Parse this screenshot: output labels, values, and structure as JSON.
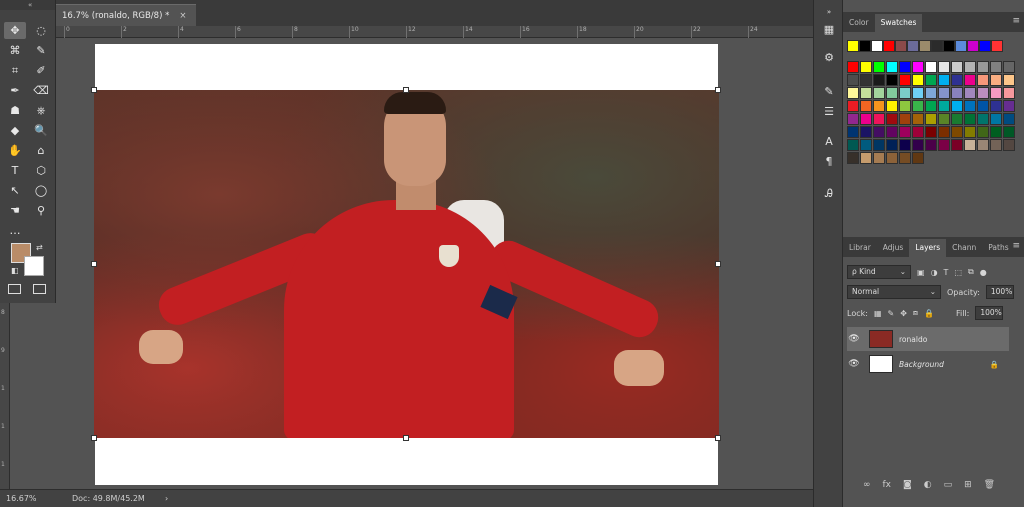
{
  "document": {
    "tab_title": "16.7% (ronaldo, RGB/8) *",
    "tab_close": "×"
  },
  "rulers": {
    "top_labels": [
      "0",
      "2",
      "4",
      "6",
      "8",
      "10",
      "12",
      "14",
      "16",
      "18",
      "20",
      "22",
      "24"
    ],
    "left_labels": [
      "8",
      "9",
      "1",
      "1",
      "1"
    ]
  },
  "toolbar": {
    "collapse": "«",
    "tools": [
      "✥",
      "◌",
      "⌘",
      "✎",
      "⌗",
      "✐",
      "✒",
      "⌫",
      "☗",
      "⎈",
      "◆",
      "🔍",
      "✋",
      "⌂",
      "T",
      "⬡",
      "↖",
      "◯",
      "☚",
      "⚲",
      "…"
    ]
  },
  "status": {
    "zoom": "16.67%",
    "doc_size": "Doc: 49.8M/45.2M",
    "arrow": "›"
  },
  "panels": {
    "color_tabs": [
      "Color",
      "Swatches"
    ],
    "layers_tabs": [
      "Librar",
      "Adjus",
      "Layers",
      "Chann",
      "Paths"
    ],
    "kind_label": "ρ Kind",
    "blend_mode": "Normal",
    "opacity_label": "Opacity:",
    "opacity_value": "100%",
    "lock_label": "Lock:",
    "fill_label": "Fill:",
    "fill_value": "100%"
  },
  "layers": [
    {
      "name": "ronaldo",
      "selected": true
    },
    {
      "name": "Background",
      "selected": false
    }
  ],
  "swatches": {
    "recent": [
      "#ffff00",
      "#000000",
      "#ffffff",
      "#ff0000",
      "#8b4a4a",
      "#6b6b9b",
      "#9b8b6b",
      "#2b2b2b",
      "#000000",
      "#5b8bdb",
      "#cc00cc",
      "#0000ff",
      "#ff3333"
    ],
    "grid": [
      "#ff0000",
      "#ffff00",
      "#00ff00",
      "#00ffff",
      "#0000ff",
      "#ff00ff",
      "#ffffff",
      "#e6e6e6",
      "#cccccc",
      "#b3b3b3",
      "#999999",
      "#808080",
      "#666666",
      "#4d4d4d",
      "#333333",
      "#1a1a1a",
      "#000000",
      "#ff0000",
      "#ffff00",
      "#00a651",
      "#00aeef",
      "#2e3192",
      "#ec008c",
      "#f7977a",
      "#f9ad81",
      "#fdc68a",
      "#fff79a",
      "#c4df9b",
      "#a2d39c",
      "#82ca9d",
      "#7bcdc8",
      "#6ecff6",
      "#7ea7d8",
      "#8493ca",
      "#8882be",
      "#a187be",
      "#bc8dbf",
      "#f49ac2",
      "#f6989d",
      "#ed1c24",
      "#f26522",
      "#f7941d",
      "#fff200",
      "#8dc73f",
      "#39b54a",
      "#00a651",
      "#00a99d",
      "#00aeef",
      "#0072bc",
      "#0054a6",
      "#2e3192",
      "#662d91",
      "#92278f",
      "#ec008c",
      "#ed145b",
      "#9e0b0f",
      "#a0410d",
      "#a36209",
      "#aba000",
      "#598527",
      "#1a7b30",
      "#007236",
      "#00746b",
      "#0076a3",
      "#004b80",
      "#003471",
      "#1b1464",
      "#440e62",
      "#630460",
      "#9e005d",
      "#9e0039",
      "#790000",
      "#7b2e00",
      "#7d4900",
      "#827b00",
      "#406618",
      "#005e20",
      "#005826",
      "#005952",
      "#005b7f",
      "#003663",
      "#002157",
      "#0d004c",
      "#32004b",
      "#4b0049",
      "#7b0046",
      "#7a0026",
      "#c7b299",
      "#998675",
      "#736357",
      "#534741",
      "#37302a",
      "#c69c6d",
      "#a67c52",
      "#8c6239",
      "#754c24",
      "#603813"
    ]
  }
}
